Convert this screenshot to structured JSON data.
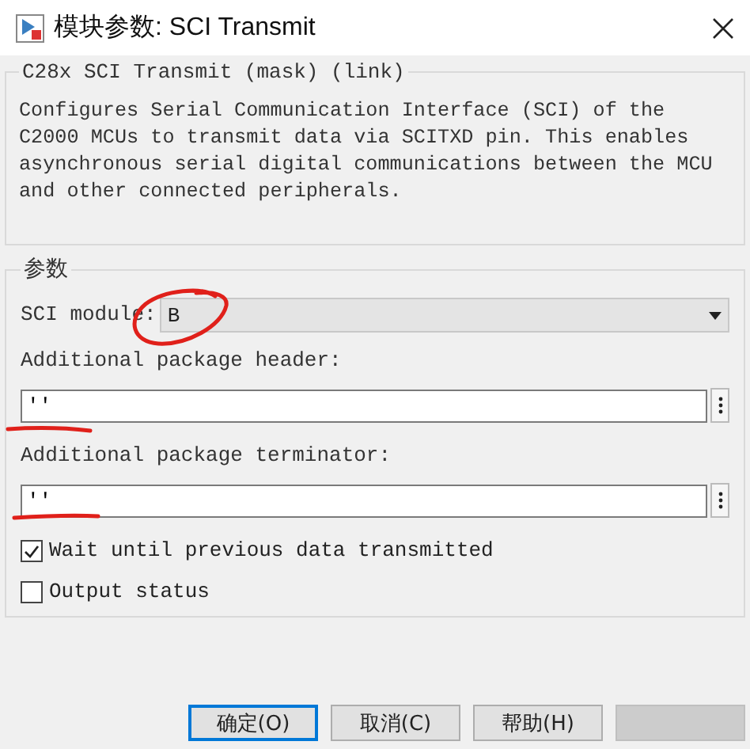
{
  "window": {
    "title": "模块参数: SCI Transmit"
  },
  "description_group": {
    "title": "C28x SCI Transmit (mask) (link)",
    "text": "Configures Serial Communication Interface (SCI) of the C2000 MCUs to transmit data via SCITXD pin. This enables asynchronous serial digital communications between the MCU and other connected peripherals."
  },
  "parameters_group": {
    "title": "参数",
    "fields": [
      {
        "kind": "dropdown",
        "label": "SCI module:",
        "value": "B"
      },
      {
        "kind": "text",
        "label": "Additional package header:",
        "value": "''"
      },
      {
        "kind": "text",
        "label": "Additional package terminator:",
        "value": "''"
      },
      {
        "kind": "checkbox",
        "label": "Wait until previous data transmitted",
        "checked": true
      },
      {
        "kind": "checkbox",
        "label": "Output status",
        "checked": false
      }
    ]
  },
  "buttons": [
    {
      "label": "确定(O)",
      "default": true,
      "disabled": false
    },
    {
      "label": "取消(C)",
      "default": false,
      "disabled": false
    },
    {
      "label": "帮助(H)",
      "default": false,
      "disabled": false
    },
    {
      "default": false,
      "disabled": true
    }
  ],
  "annotations": [
    {
      "kind": "circle"
    },
    {
      "kind": "underline"
    },
    {
      "kind": "underline"
    }
  ]
}
